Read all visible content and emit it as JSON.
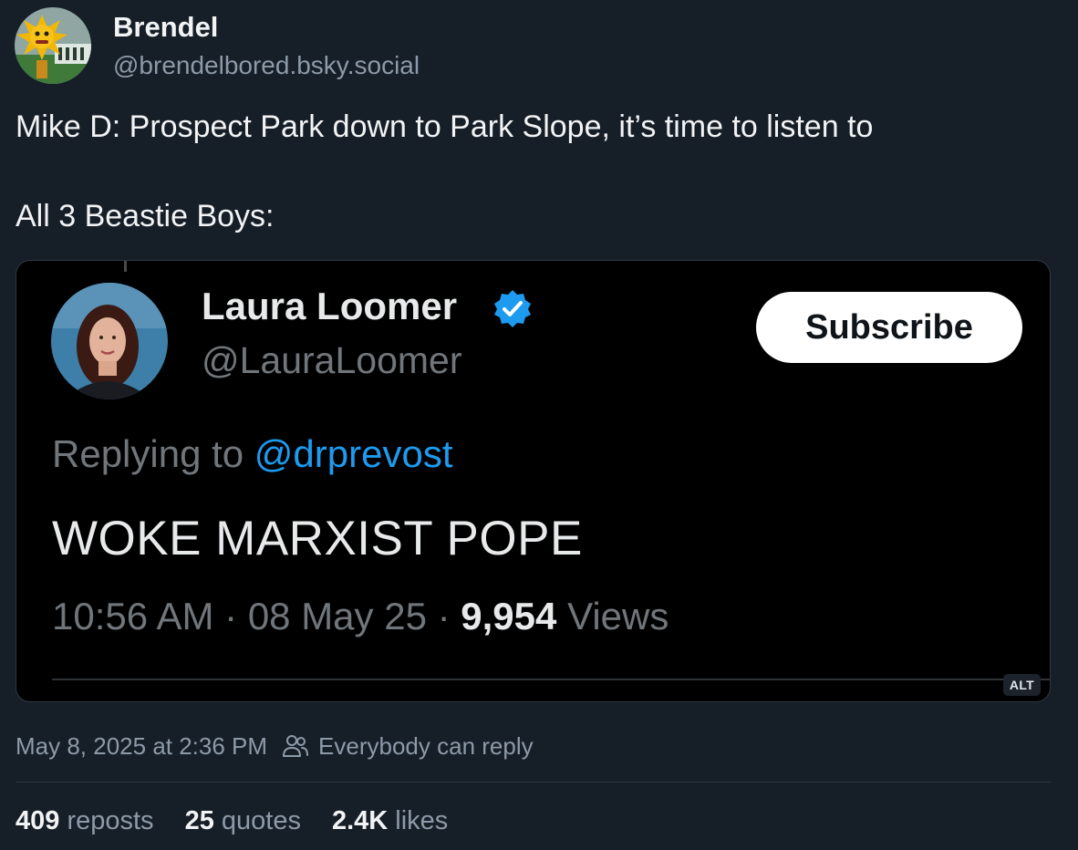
{
  "author": {
    "display_name": "Brendel",
    "handle": "@brendelbored.bsky.social"
  },
  "post": {
    "text_line_1": "Mike D: Prospect Park down to Park Slope, it’s time to listen to",
    "text_line_2": "All 3 Beastie Boys:"
  },
  "embed": {
    "alt_badge": "ALT",
    "tweet": {
      "name": "Laura Loomer",
      "handle": "@LauraLoomer",
      "subscribe_label": "Subscribe",
      "replying_prefix": "Replying to",
      "replying_handle": "@drprevost",
      "body": "WOKE MARXIST POPE",
      "time": "10:56 AM",
      "separator": "·",
      "date": "08 May 25",
      "views_count": "9,954",
      "views_label": "Views"
    }
  },
  "meta": {
    "timestamp": "May 8, 2025 at 2:36 PM",
    "reply_setting": "Everybody can reply"
  },
  "stats": {
    "reposts_count": "409",
    "reposts_label": "reposts",
    "quotes_count": "25",
    "quotes_label": "quotes",
    "likes_count": "2.4K",
    "likes_label": "likes"
  },
  "colors": {
    "background": "#161e27",
    "muted": "#8d9aa8",
    "twitter_blue": "#1d9bf0"
  }
}
